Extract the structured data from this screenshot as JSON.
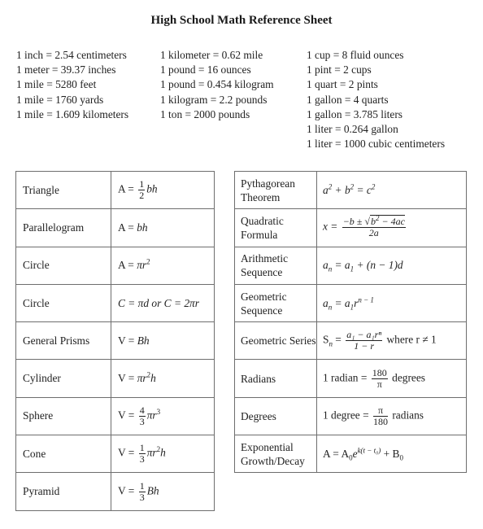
{
  "title": "High School Math Reference Sheet",
  "conversions": [
    [
      "1 inch = 2.54 centimeters",
      "1 meter = 39.37 inches",
      "1 mile = 5280 feet",
      "1 mile = 1760 yards",
      "1 mile = 1.609 kilometers"
    ],
    [
      "1 kilometer = 0.62 mile",
      "1 pound = 16 ounces",
      "1 pound = 0.454 kilogram",
      "1 kilogram = 2.2 pounds",
      "1 ton = 2000 pounds"
    ],
    [
      "1 cup = 8 fluid ounces",
      "1 pint = 2 cups",
      "1 quart = 2 pints",
      "1 gallon = 4 quarts",
      "1 gallon = 3.785 liters",
      "1 liter = 0.264 gallon",
      "1 liter = 1000 cubic centimeters"
    ]
  ],
  "left_table": [
    {
      "name": "Triangle",
      "formula": {
        "lhs": "A =",
        "num": "1",
        "den": "2",
        "rest": "bh"
      }
    },
    {
      "name": "Parallelogram",
      "formula": {
        "lhs": "A =",
        "rest": "bh"
      }
    },
    {
      "name": "Circle",
      "formula": {
        "lhs": "A =",
        "rest": "πr",
        "sup": "2"
      }
    },
    {
      "name": "Circle",
      "formula": {
        "text": "C = πd or C = 2πr"
      }
    },
    {
      "name": "General Prisms",
      "formula": {
        "lhs": "V =",
        "rest": "Bh"
      }
    },
    {
      "name": "Cylinder",
      "formula": {
        "lhs": "V =",
        "rest": "πr",
        "sup": "2",
        "after": "h"
      }
    },
    {
      "name": "Sphere",
      "formula": {
        "lhs": "V =",
        "num": "4",
        "den": "3",
        "rest": "πr",
        "sup": "3"
      }
    },
    {
      "name": "Cone",
      "formula": {
        "lhs": "V =",
        "num": "1",
        "den": "3",
        "rest": "πr",
        "sup": "2",
        "after": "h"
      }
    },
    {
      "name": "Pyramid",
      "formula": {
        "lhs": "V =",
        "num": "1",
        "den": "3",
        "rest": "Bh"
      }
    }
  ],
  "right_table": [
    {
      "name": "Pythagorean Theorem",
      "formula": "a² + b² = c²"
    },
    {
      "name": "Quadratic Formula",
      "formula": "x = (−b ± √(b² − 4ac)) / 2a"
    },
    {
      "name": "Arithmetic Sequence",
      "formula": "aₙ = a₁ + (n − 1)d"
    },
    {
      "name": "Geometric Sequence",
      "formula": "aₙ = a₁rⁿ⁻¹"
    },
    {
      "name": "Geometric Series",
      "formula": "Sₙ = (a₁ − a₁rⁿ) / (1 − r) where r ≠ 1"
    },
    {
      "name": "Radians",
      "formula": "1 radian = 180/π degrees"
    },
    {
      "name": "Degrees",
      "formula": "1 degree = π/180 radians"
    },
    {
      "name": "Exponential Growth/Decay",
      "formula": "A = A₀e^(k(t − t₀)) + B₀"
    }
  ],
  "right_parts": {
    "pyth": {
      "a": "a",
      "b": "b",
      "c": "c",
      "two": "2"
    },
    "quad": {
      "lhs": "x =",
      "num_a": "−b ±",
      "rad": "b",
      "rad_sup": "2",
      "rad_rest": " − 4ac",
      "den": "2a"
    },
    "arith": {
      "lhs": "a",
      "sub": "n",
      "eq": " = a",
      "sub1": "1",
      "rest": " + (n − 1)d"
    },
    "geoseq": {
      "lhs": "a",
      "sub": "n",
      "eq": " = a",
      "sub1": "1",
      "r": "r",
      "sup": "n − 1"
    },
    "geoser": {
      "lhs": "S",
      "sub": "n",
      "eq": " =",
      "num": "a₁ − a₁rⁿ",
      "den": "1 − r",
      "tail": "where r ≠ 1"
    },
    "rad": {
      "lhs": "1 radian =",
      "num": "180",
      "den": "π",
      "tail": "degrees"
    },
    "deg": {
      "lhs": "1 degree =",
      "num": "π",
      "den": "180",
      "tail": "radians"
    },
    "exp": {
      "lhs": "A = A",
      "sub0": "0",
      "e": "e",
      "sup": "k(t − t₀)",
      "plus": " + B",
      "subb": "0"
    }
  }
}
